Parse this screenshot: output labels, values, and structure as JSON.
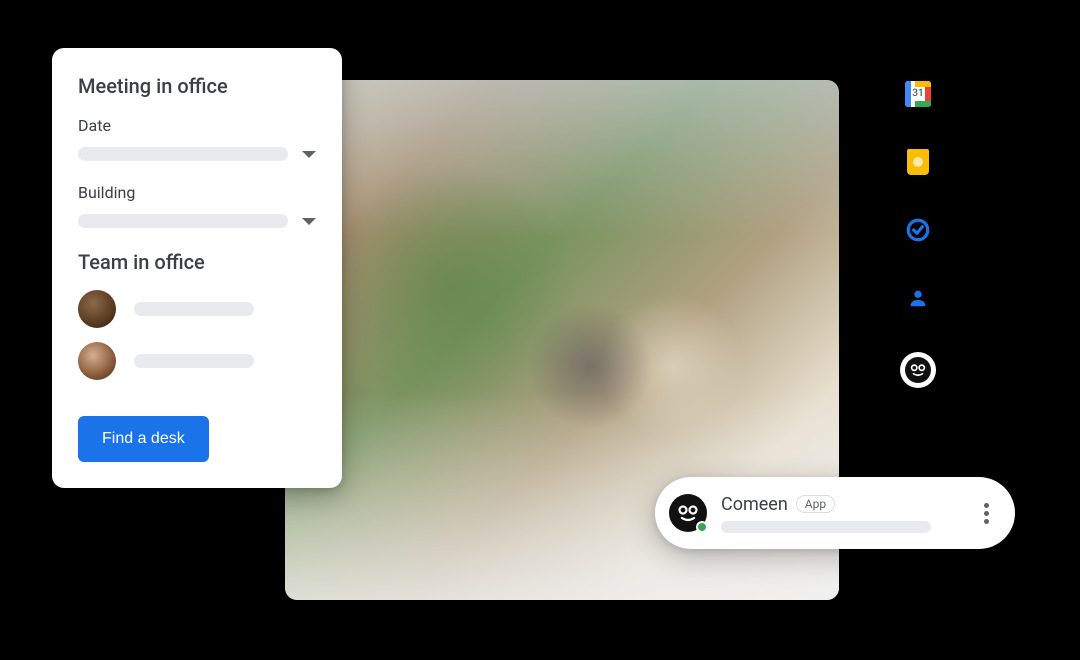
{
  "meeting_card": {
    "title": "Meeting in office",
    "date_label": "Date",
    "building_label": "Building",
    "team_section_title": "Team in office",
    "button_label": "Find a desk"
  },
  "side_rail": {
    "calendar_day": "31",
    "icons": {
      "calendar": "calendar-icon",
      "keep": "keep-icon",
      "tasks": "tasks-icon",
      "contacts": "contacts-icon",
      "comeen": "comeen-icon"
    }
  },
  "chat_pill": {
    "name": "Comeen",
    "badge": "App"
  },
  "colors": {
    "primary": "#1a73e8",
    "keep_yellow": "#fbbc04",
    "presence_green": "#34a853"
  }
}
